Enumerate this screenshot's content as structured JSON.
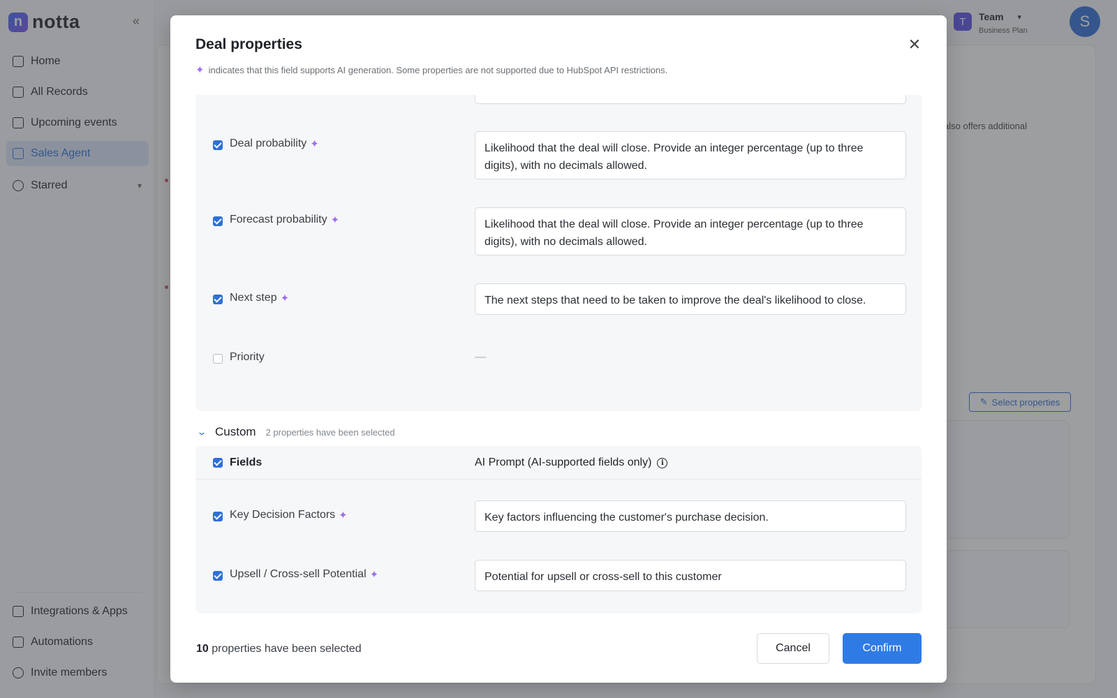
{
  "app": {
    "logo_text": "notta",
    "logo_letter": "n",
    "collapse_icon": "«"
  },
  "sidebar": {
    "items": [
      {
        "label": "Home",
        "icon": "home-icon"
      },
      {
        "label": "All Records",
        "icon": "folder-icon"
      },
      {
        "label": "Upcoming events",
        "icon": "calendar-icon"
      },
      {
        "label": "Sales Agent",
        "icon": "robot-icon",
        "active": true
      }
    ],
    "starred": {
      "label": "Starred",
      "icon": "star-icon"
    },
    "bottom_items": [
      {
        "label": "Integrations & Apps",
        "icon": "apps-icon"
      },
      {
        "label": "Automations",
        "icon": "automation-icon"
      },
      {
        "label": "Invite members",
        "icon": "user-plus-icon"
      }
    ]
  },
  "header": {
    "team_letter": "T",
    "team_name": "Team",
    "team_plan": "Business Plan",
    "avatar_letter": "S"
  },
  "background": {
    "text_snippet": "also offers additional",
    "select_properties_label": "Select properties"
  },
  "modal": {
    "title": "Deal properties",
    "close_icon": "✕",
    "note": "indicates that this field supports AI generation. Some properties are not supported due to HubSpot API restrictions.",
    "sparkle_icon": "✦",
    "rows": [
      {
        "label": "Deal probability",
        "checked": true,
        "ai": true,
        "prompt": "Likelihood that the deal will close. Provide an integer percentage (up to three digits), with no decimals allowed."
      },
      {
        "label": "Forecast probability",
        "checked": true,
        "ai": true,
        "prompt": "Likelihood that the deal will close. Provide an integer percentage (up to three digits), with no decimals allowed."
      },
      {
        "label": "Next step",
        "checked": true,
        "ai": true,
        "prompt": "The next steps that need to be taken to improve the deal's likelihood to close."
      },
      {
        "label": "Priority",
        "checked": false,
        "ai": false,
        "prompt": "—"
      }
    ],
    "custom": {
      "title": "Custom",
      "count_text": "2 properties have been selected",
      "header_fields": "Fields",
      "header_prompt": "AI Prompt (AI-supported fields only)",
      "info_icon": "i",
      "rows": [
        {
          "label": "Key Decision Factors",
          "checked": true,
          "ai": true,
          "prompt": "Key factors influencing the customer's purchase decision."
        },
        {
          "label": "Upsell / Cross-sell Potential",
          "checked": true,
          "ai": true,
          "prompt": "Potential for upsell or cross-sell to this customer"
        }
      ]
    },
    "footer": {
      "count": "10",
      "count_suffix": "properties have been selected",
      "cancel_label": "Cancel",
      "confirm_label": "Confirm"
    }
  }
}
